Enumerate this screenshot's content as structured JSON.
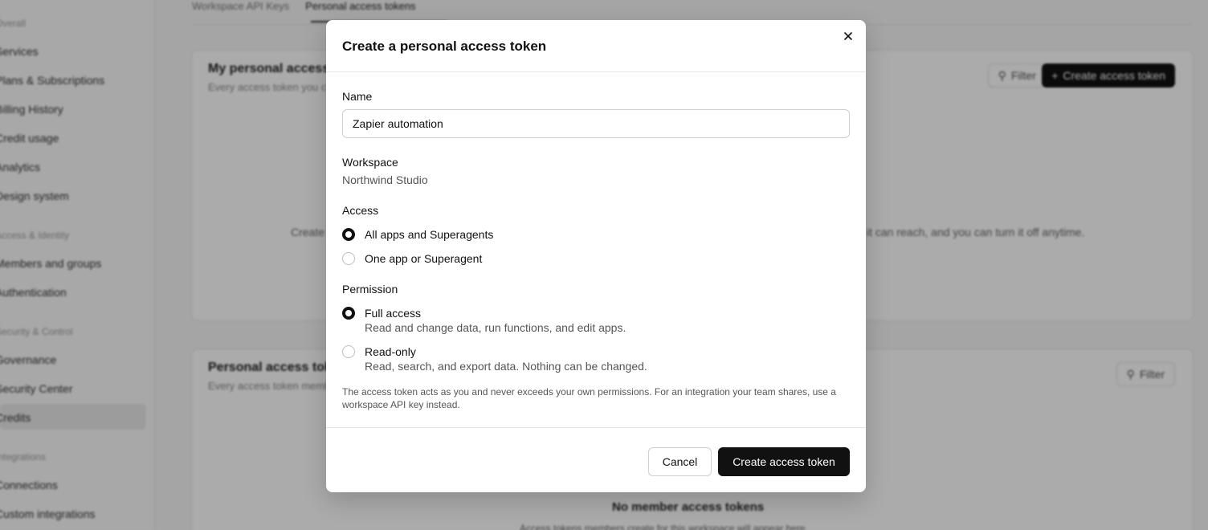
{
  "background": {
    "sidebar": {
      "sections": [
        "Overall",
        "Access & Identity",
        "Security & Control",
        "Integrations"
      ],
      "items": [
        "Services",
        "Plans & Subscriptions",
        "Billing History",
        "Credit usage",
        "Analytics",
        "Design system",
        "Members and groups",
        "Authentication",
        "Governance",
        "Security Center",
        "Credits",
        "Connections",
        "Custom integrations"
      ]
    },
    "tabs": [
      "Workspace API Keys",
      "Personal access tokens"
    ],
    "card1": {
      "title": "My personal access tokens",
      "subtitle": "Every access token you create acts as you",
      "filter": "Filter",
      "create": "Create access token",
      "empty_text_left": "Create a",
      "empty_text_right": "it can reach, and you can turn it off anytime."
    },
    "card2": {
      "title": "Personal access tokens",
      "subtitle": "Every access token members create",
      "filter": "Filter",
      "empty_title": "No member access tokens",
      "empty_desc": "Access tokens members create for this workspace will appear here."
    }
  },
  "modal": {
    "title": "Create a personal access token",
    "name": {
      "label": "Name",
      "value": "Zapier automation"
    },
    "workspace": {
      "label": "Workspace",
      "value": "Northwind Studio"
    },
    "access": {
      "label": "Access",
      "options": [
        {
          "label": "All apps and Superagents",
          "checked": true
        },
        {
          "label": "One app or Superagent",
          "checked": false
        }
      ]
    },
    "permission": {
      "label": "Permission",
      "options": [
        {
          "label": "Full access",
          "desc": "Read and change data, run functions, and edit apps.",
          "checked": true
        },
        {
          "label": "Read-only",
          "desc": "Read, search, and export data. Nothing can be changed.",
          "checked": false
        }
      ]
    },
    "note": "The access token acts as you and never exceeds your own permissions. For an integration your team shares, use a workspace API key instead.",
    "cancel_label": "Cancel",
    "create_label": "Create access token"
  }
}
